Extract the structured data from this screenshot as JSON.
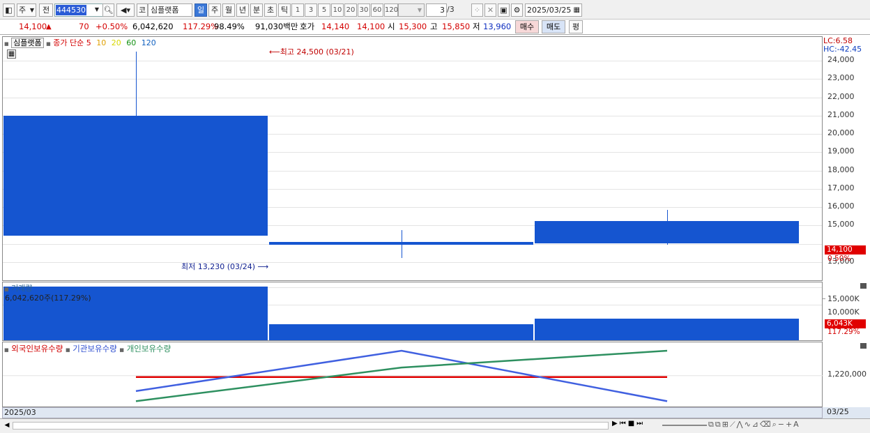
{
  "toolbar": {
    "period_type": "주",
    "prefix": "전",
    "stock_code": "444530",
    "market": "코",
    "stock_name": "심플랫폼",
    "periods": [
      "일",
      "주",
      "월",
      "년",
      "분",
      "초",
      "틱"
    ],
    "selected_period": "일",
    "intervals": [
      "1",
      "3",
      "5",
      "10",
      "20",
      "30",
      "60",
      "120"
    ],
    "page": "3",
    "page_total": "/3",
    "date": "2025/03/25"
  },
  "info": {
    "price": "14,100",
    "change": "70",
    "change_pct": "+0.50%",
    "volume": "6,042,620",
    "volume_ratio": "117.29%",
    "rotation": "98.49%",
    "amount": "91,030백만",
    "quote_label": "호가",
    "ask": "14,140",
    "bid": "14,100",
    "open_label": "시",
    "open": "15,300",
    "high_label": "고",
    "high": "15,850",
    "low_label": "저",
    "low": "13,960",
    "buy_label": "매수",
    "sell_label": "매도",
    "avg_label": "평"
  },
  "price_panel": {
    "name": "심플랫폼",
    "ma_label": "종가 단순",
    "ma_periods": [
      "5",
      "10",
      "20",
      "60",
      "120"
    ],
    "ma_colors": [
      "#d40000",
      "#e0a000",
      "#e8e000",
      "#109010",
      "#1060c0"
    ],
    "high_note": "최고 24,500 (03/21)",
    "low_note": "최저 13,230 (03/24)",
    "lc_label": "LC:6.58",
    "hc_label": "HC:-42.45",
    "y_ticks": [
      "24,000",
      "23,000",
      "22,000",
      "21,000",
      "20,000",
      "19,000",
      "18,000",
      "17,000",
      "16,000",
      "15,000",
      "13,000"
    ],
    "current_tag": "14,100",
    "current_pct": "0.50%"
  },
  "chart_data": [
    {
      "type": "candlestick",
      "title": "심플랫폼",
      "categories": [
        "03/21",
        "03/24",
        "03/25"
      ],
      "open": [
        21000,
        14100,
        15250
      ],
      "close": [
        14450,
        14030,
        14030
      ],
      "high": [
        24500,
        14750,
        15850
      ],
      "low": [
        14450,
        13230,
        13960
      ],
      "ylim": [
        12500,
        24500
      ]
    },
    {
      "type": "bar",
      "title": "거래량",
      "categories": [
        "03/21",
        "03/24",
        "03/25"
      ],
      "values": [
        15100000,
        4600000,
        6042620
      ],
      "ylim": [
        0,
        17000000
      ]
    },
    {
      "type": "line",
      "categories": [
        "03/21",
        "03/24",
        "03/25"
      ],
      "series": [
        {
          "name": "외국인보유수량",
          "color": "#e00000",
          "values": [
            1220000,
            1220000,
            1220000
          ]
        },
        {
          "name": "기관보유수량",
          "color": "#4060e0",
          "values": [
            1195000,
            1267000,
            1177000
          ]
        },
        {
          "name": "개인보유수량",
          "color": "#2e9060",
          "values": [
            1177000,
            1237000,
            1267000
          ]
        }
      ]
    }
  ],
  "volume_panel": {
    "label": "거래량",
    "value_label": "6,042,620주(117.29%)",
    "y_ticks": [
      "15,000K",
      "10,000K"
    ],
    "current_tag": "6,043K",
    "current_pct": "117.29%"
  },
  "holding_panel": {
    "legend": [
      "외국인보유수량",
      "기관보유수량",
      "개인보유수량"
    ],
    "y_tick": "1,220,000"
  },
  "xaxis": {
    "left_label": "2025/03",
    "right_label": "03/25"
  }
}
